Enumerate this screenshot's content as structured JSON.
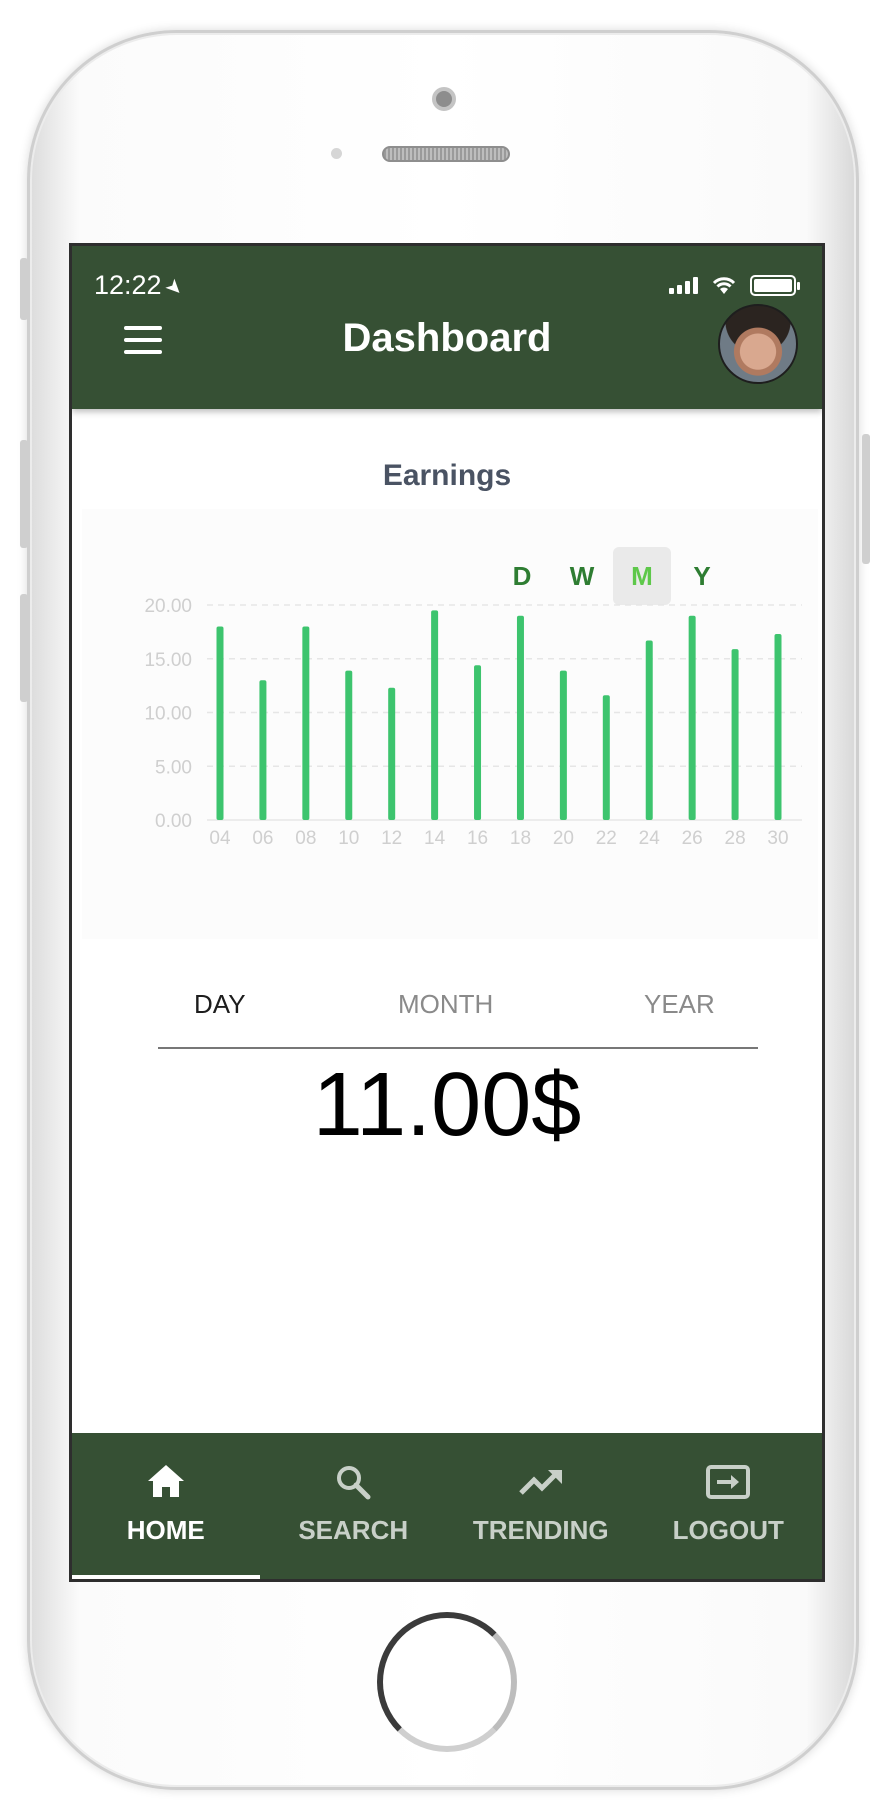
{
  "status_bar": {
    "time": "12:22"
  },
  "header": {
    "title": "Dashboard"
  },
  "card": {
    "title": "Earnings"
  },
  "period_selector": [
    {
      "label": "D",
      "active": false
    },
    {
      "label": "W",
      "active": false
    },
    {
      "label": "M",
      "active": true
    },
    {
      "label": "Y",
      "active": false
    }
  ],
  "chart_data": {
    "type": "bar",
    "categories": [
      "04",
      "06",
      "08",
      "10",
      "12",
      "14",
      "16",
      "18",
      "20",
      "22",
      "24",
      "26",
      "28",
      "30"
    ],
    "values": [
      18.0,
      13.0,
      18.0,
      13.9,
      12.3,
      19.5,
      14.4,
      19.0,
      13.9,
      11.6,
      16.7,
      19.0,
      15.9,
      17.3
    ],
    "y_ticks": [
      "0.00",
      "5.00",
      "10.00",
      "15.00",
      "20.00"
    ],
    "ylim": [
      0,
      20
    ],
    "grid": true,
    "bar_color": "#3dc46e",
    "title": "",
    "xlabel": "",
    "ylabel": ""
  },
  "tabs": [
    {
      "label": "DAY",
      "active": true
    },
    {
      "label": "MONTH",
      "active": false
    },
    {
      "label": "YEAR",
      "active": false
    }
  ],
  "amount": "11.00$",
  "bottom_nav": [
    {
      "label": "HOME",
      "icon": "home-icon",
      "active": true
    },
    {
      "label": "SEARCH",
      "icon": "search-icon",
      "active": false
    },
    {
      "label": "TRENDING",
      "icon": "trending-icon",
      "active": false
    },
    {
      "label": "LOGOUT",
      "icon": "logout-icon",
      "active": false
    }
  ],
  "colors": {
    "header": "#365034",
    "accent": "#3dc46e",
    "selector_active": "#5ec84a"
  }
}
